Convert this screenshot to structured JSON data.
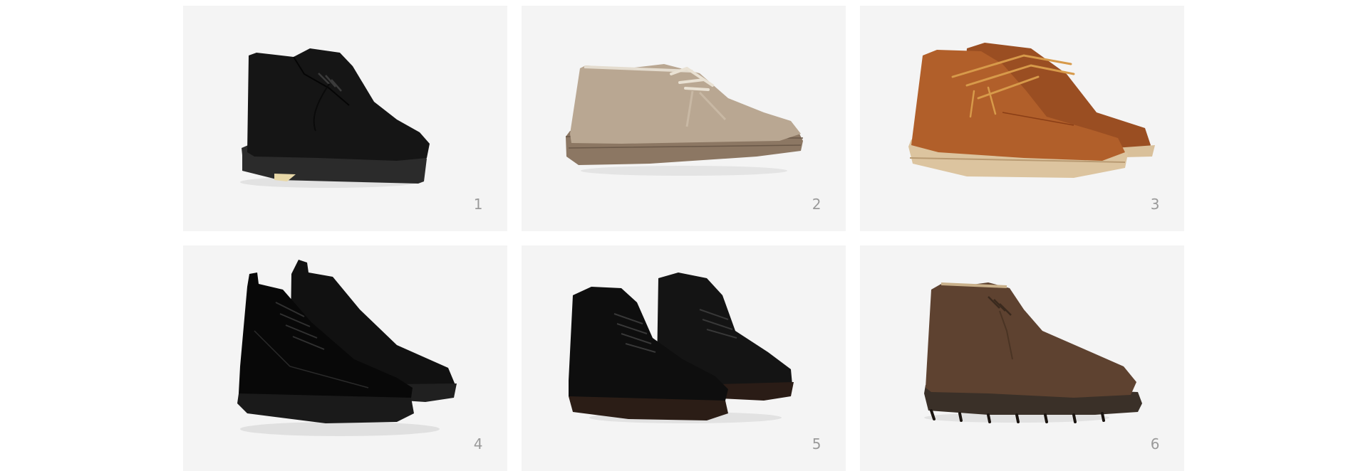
{
  "gallery": {
    "items": [
      {
        "number": "1",
        "image": "black-suede-desert-boot"
      },
      {
        "number": "2",
        "image": "taupe-suede-desert-boot"
      },
      {
        "number": "3",
        "image": "tan-leather-chukka-pair"
      },
      {
        "number": "4",
        "image": "black-leather-chukka-pair"
      },
      {
        "number": "5",
        "image": "black-pebbled-leather-chukka-pair"
      },
      {
        "number": "6",
        "image": "brown-suede-chukka-boot"
      }
    ]
  },
  "colors": {
    "tile_background": "#f4f4f4",
    "number_text": "#9a9a9a"
  }
}
